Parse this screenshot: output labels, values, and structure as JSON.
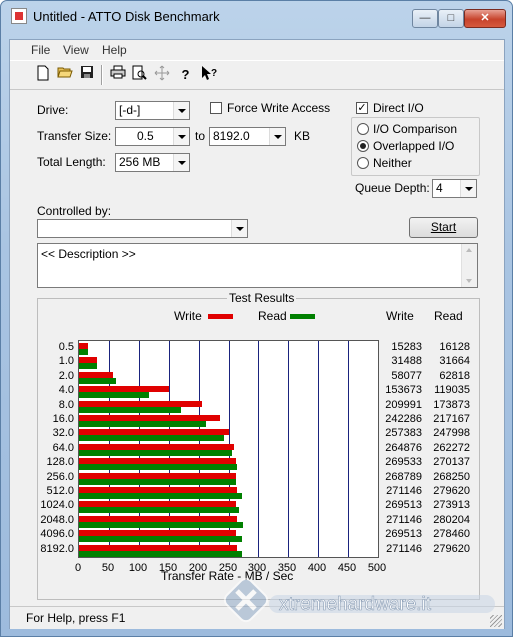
{
  "window": {
    "title": "Untitled - ATTO Disk Benchmark",
    "minimize": "—",
    "maximize": "□",
    "close": "✕"
  },
  "menu": {
    "items": [
      "File",
      "View",
      "Help"
    ]
  },
  "toolbar": {
    "icons": [
      "new-icon",
      "open-icon",
      "save-icon",
      "print-icon",
      "print-preview-icon",
      "move-icon",
      "help-icon",
      "context-help-icon"
    ]
  },
  "settings": {
    "drive_label": "Drive:",
    "drive_value": "[-d-]",
    "transfer_size_label": "Transfer Size:",
    "transfer_from": "0.5",
    "to_label": "to",
    "transfer_to": "8192.0",
    "kb_label": "KB",
    "total_length_label": "Total Length:",
    "total_length_value": "256 MB",
    "force_write_access_label": "Force Write Access",
    "force_write_access_checked": false,
    "direct_io_label": "Direct I/O",
    "direct_io_checked": true,
    "io_comparison_label": "I/O Comparison",
    "overlapped_io_label": "Overlapped I/O",
    "neither_label": "Neither",
    "selected_mode": "Overlapped I/O",
    "queue_depth_label": "Queue Depth:",
    "queue_depth_value": "4",
    "controlled_by_label": "Controlled by:",
    "controlled_by_value": "",
    "start_label": "Start",
    "description": "<< Description >>"
  },
  "results": {
    "group_title": "Test Results",
    "legend_write": "Write",
    "legend_read": "Read",
    "col_write": "Write",
    "col_read": "Read",
    "write_color": "#e00000",
    "read_color": "#008000"
  },
  "chart_data": {
    "type": "bar",
    "orientation": "horizontal",
    "title": "Test Results",
    "xlabel": "Transfer Rate - MB / Sec",
    "ylabel": "",
    "xlim": [
      0,
      500
    ],
    "xticks": [
      "0",
      "50",
      "100",
      "150",
      "200",
      "250",
      "300",
      "350",
      "400",
      "450",
      "500"
    ],
    "categories": [
      "0.5",
      "1.0",
      "2.0",
      "4.0",
      "8.0",
      "16.0",
      "32.0",
      "64.0",
      "128.0",
      "256.0",
      "512.0",
      "1024.0",
      "2048.0",
      "4096.0",
      "8192.0"
    ],
    "series": [
      {
        "name": "Write",
        "color": "#e00000",
        "values": [
          15283,
          31488,
          58077,
          153673,
          209991,
          242286,
          257383,
          264876,
          269533,
          268789,
          271146,
          269513,
          271146,
          269513,
          271146
        ]
      },
      {
        "name": "Read",
        "color": "#008000",
        "values": [
          16128,
          31664,
          62818,
          119035,
          173873,
          217167,
          247998,
          262272,
          270137,
          268250,
          279620,
          273913,
          280204,
          278460,
          279620
        ]
      }
    ],
    "value_units": "KB/s",
    "grid": true
  },
  "status": {
    "text": "For Help, press F1"
  },
  "watermark": {
    "text": "xtremehardware.it"
  }
}
